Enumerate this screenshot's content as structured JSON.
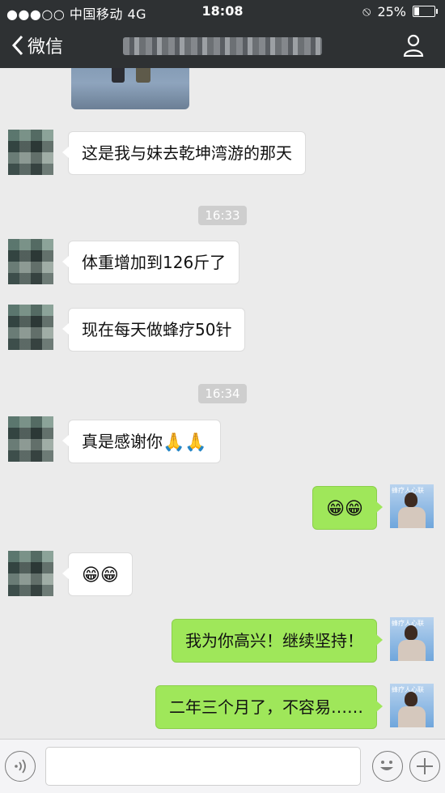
{
  "status_bar": {
    "carrier": "●●●○○ 中国移动  4G",
    "time": "18:08",
    "battery": "25%",
    "battery_level": 0.25
  },
  "nav": {
    "back_label": "微信",
    "chat_title": "",
    "profile_icon": "person-icon"
  },
  "messages": [
    {
      "type": "image",
      "side": "left"
    },
    {
      "type": "text",
      "side": "left",
      "text": "这是我与妹去乾坤湾游的那天"
    },
    {
      "type": "time",
      "text": "16:33"
    },
    {
      "type": "text",
      "side": "left",
      "text": "体重增加到126斤了"
    },
    {
      "type": "text",
      "side": "left",
      "text": "现在每天做蜂疗50针"
    },
    {
      "type": "time",
      "text": "16:34"
    },
    {
      "type": "text",
      "side": "left",
      "text": "真是感谢你",
      "emoji": "🙏🙏"
    },
    {
      "type": "emoji",
      "side": "right",
      "emoji": "😁😁"
    },
    {
      "type": "emoji",
      "side": "left",
      "emoji": "😁😁"
    },
    {
      "type": "text",
      "side": "right",
      "text": "我为你高兴！继续坚持！"
    },
    {
      "type": "text",
      "side": "right",
      "text": "二年三个月了，不容易……"
    }
  ],
  "avatar_right_sign": "蜂疗人心联",
  "input_bar": {
    "voice_icon": "voice-icon",
    "emoji_icon": "smiley-icon",
    "plus_icon": "plus-icon",
    "placeholder": ""
  },
  "colors": {
    "nav_bg": "#2e3133",
    "chat_bg": "#ebebeb",
    "bubble_right": "#9fe75a",
    "bubble_left": "#ffffff"
  }
}
